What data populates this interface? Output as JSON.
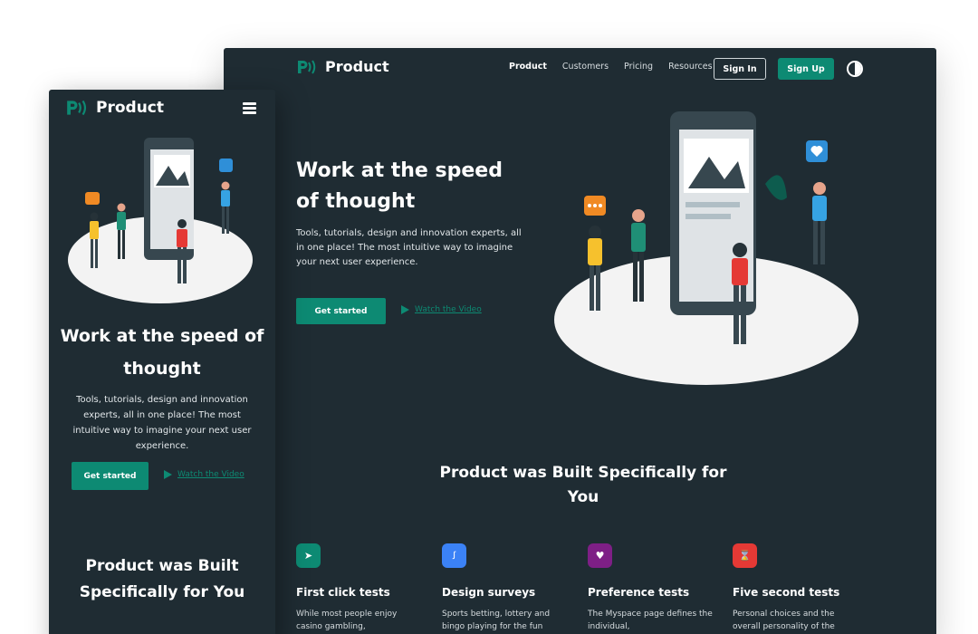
{
  "brand": {
    "name": "Product",
    "accent": "#0d8a73",
    "background": "#1f2c33"
  },
  "desktop": {
    "nav": {
      "links": [
        "Product",
        "Customers",
        "Pricing",
        "Resources"
      ],
      "sign_in": "Sign In",
      "sign_up": "Sign Up",
      "theme_toggle_icon": "contrast-icon"
    },
    "hero": {
      "title": "Work at the speed of thought",
      "description": "Tools, tutorials, design and innovation experts, all in one place! The most intuitive way to imagine your next user experience.",
      "cta": "Get started",
      "video_link": "Watch the Video"
    },
    "section": {
      "title": "Product  was Built Specifically for You",
      "features": [
        {
          "icon": "cursor-icon",
          "color": "#0d8a73",
          "title": "First click tests",
          "text": "While most people enjoy casino gambling,"
        },
        {
          "icon": "stumbleupon-icon",
          "color": "#3b82f6",
          "title": "Design surveys",
          "text": "Sports betting, lottery and bingo playing for the fun"
        },
        {
          "icon": "heart-icon",
          "color": "#7e1f86",
          "title": "Preference tests",
          "text": "The Myspace page defines the individual,"
        },
        {
          "icon": "hourglass-icon",
          "color": "#e53935",
          "title": "Five second tests",
          "text": "Personal choices and the overall personality of the"
        }
      ]
    }
  },
  "mobile": {
    "menu_icon": "hamburger-icon",
    "hero": {
      "title": "Work at the speed of thought",
      "description": "Tools, tutorials, design and innovation experts, all in one place! The most intuitive way to imagine your next user experience.",
      "cta": "Get started",
      "video_link": "Watch the Video"
    },
    "section": {
      "title": "Product  was Built Specifically for You"
    }
  }
}
